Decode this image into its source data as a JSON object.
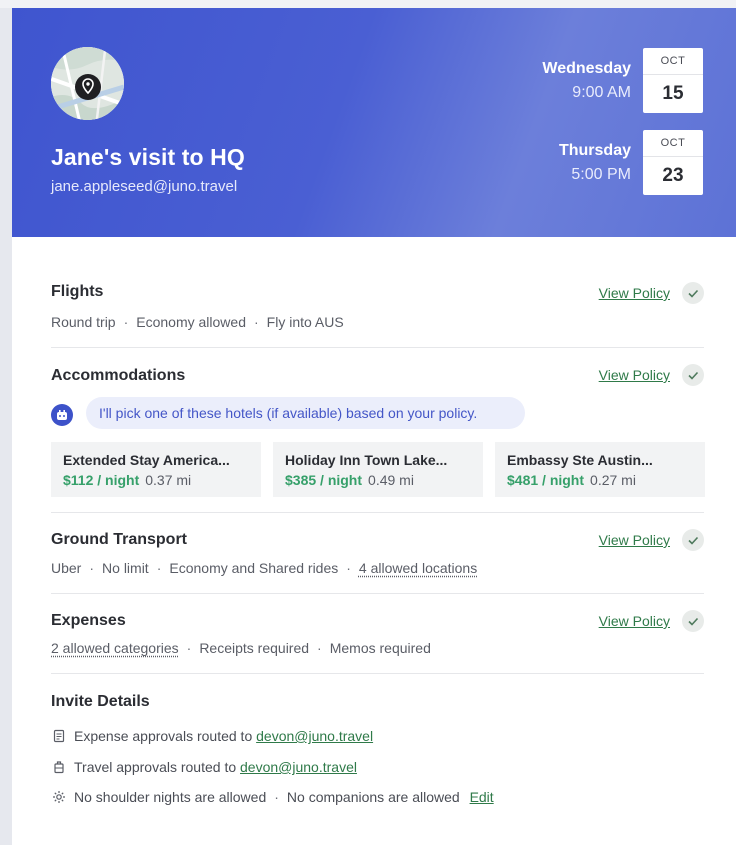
{
  "header": {
    "title": "Jane's visit to HQ",
    "email": "jane.appleseed@juno.travel",
    "start": {
      "day": "Wednesday",
      "time": "9:00 AM",
      "month": "OCT",
      "date": "15"
    },
    "end": {
      "day": "Thursday",
      "time": "5:00 PM",
      "month": "OCT",
      "date": "23"
    }
  },
  "flights": {
    "title": "Flights",
    "details": [
      "Round trip",
      "Economy allowed",
      "Fly into AUS"
    ],
    "policy_label": "View Policy"
  },
  "accommodations": {
    "title": "Accommodations",
    "policy_label": "View Policy",
    "note": "I'll pick one of these hotels (if available) based on your policy.",
    "hotels": [
      {
        "name": "Extended Stay America...",
        "price": "$112 / night",
        "distance": "0.37 mi"
      },
      {
        "name": "Holiday Inn Town Lake...",
        "price": "$385 / night",
        "distance": "0.49 mi"
      },
      {
        "name": "Embassy Ste Austin...",
        "price": "$481 / night",
        "distance": "0.27 mi"
      }
    ]
  },
  "ground": {
    "title": "Ground Transport",
    "details": [
      "Uber",
      "No limit",
      "Economy and Shared rides"
    ],
    "link": "4 allowed locations",
    "policy_label": "View Policy"
  },
  "expenses": {
    "title": "Expenses",
    "link": "2 allowed categories",
    "details": [
      "Receipts required",
      "Memos required"
    ],
    "policy_label": "View Policy"
  },
  "invite": {
    "title": "Invite Details",
    "expense_text": "Expense approvals routed to",
    "expense_email": "devon@juno.travel",
    "travel_text": "Travel approvals routed to",
    "travel_email": "devon@juno.travel",
    "nights_text": "No shoulder nights are allowed",
    "companions_text": "No companions are allowed",
    "edit_label": "Edit"
  },
  "colors": {
    "header_blue": "#3f55cf",
    "link_green": "#2f7a49",
    "price_green": "#36a06a",
    "note_blue": "#4456c7"
  }
}
